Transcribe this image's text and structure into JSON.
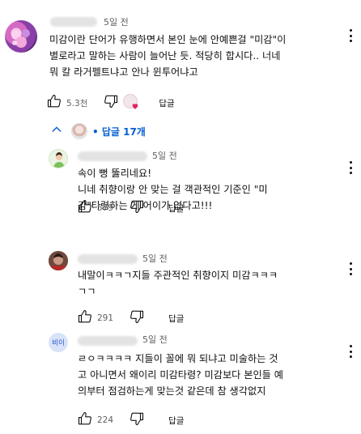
{
  "comments": [
    {
      "time": "5일 전",
      "lines": [
        "미감이란 단어가 유행하면서 본인 눈에 안예쁜걸 \"미감\"이",
        "별로라고 말하는 사람이 늘어난 듯. 적당히 합시다.. 너네",
        "뭐 칼 라거펠트냐고 안나 윈투어냐고"
      ],
      "likes": "5.3천",
      "reply_label": "답글",
      "replies_toggle": "• 답글 17개"
    },
    {
      "time": "5일 전",
      "lines": [
        "속이 뻥 뚫리네요!",
        "니네 취향이랑 안 맞는 걸 객관적인 기준인 \"미",
        "감\"타령하는 게 어이가 없다고!!!"
      ],
      "likes": "579",
      "reply_label": "답글"
    },
    {
      "time": "5일 전",
      "lines": [
        "내말이ㅋㅋㄱ지들 주관적인 취향이지 미감ㅋㅋㅋ",
        "ㄱㄱ"
      ],
      "likes": "291",
      "reply_label": "답글"
    },
    {
      "time": "5일 전",
      "avatar_text": "비이",
      "lines": [
        "ㄹㅇㅋㅋㅋㅋ 지들이 꼴에 뭐 되냐고 미술하는 것",
        "고 아니면서 왜이리 미감타령? 미감보다 본인들 예",
        "의부터 점검하는게 맞는것 같은데 참 생각없지"
      ],
      "likes": "224",
      "reply_label": "답글"
    }
  ],
  "colors": {
    "link_blue": "#065fd4",
    "text": "#0f0f0f",
    "muted": "#606060"
  },
  "icons": [
    "thumbs-up-icon",
    "thumbs-down-icon",
    "more-vert-icon",
    "chevron-up-icon",
    "heart-icon"
  ]
}
